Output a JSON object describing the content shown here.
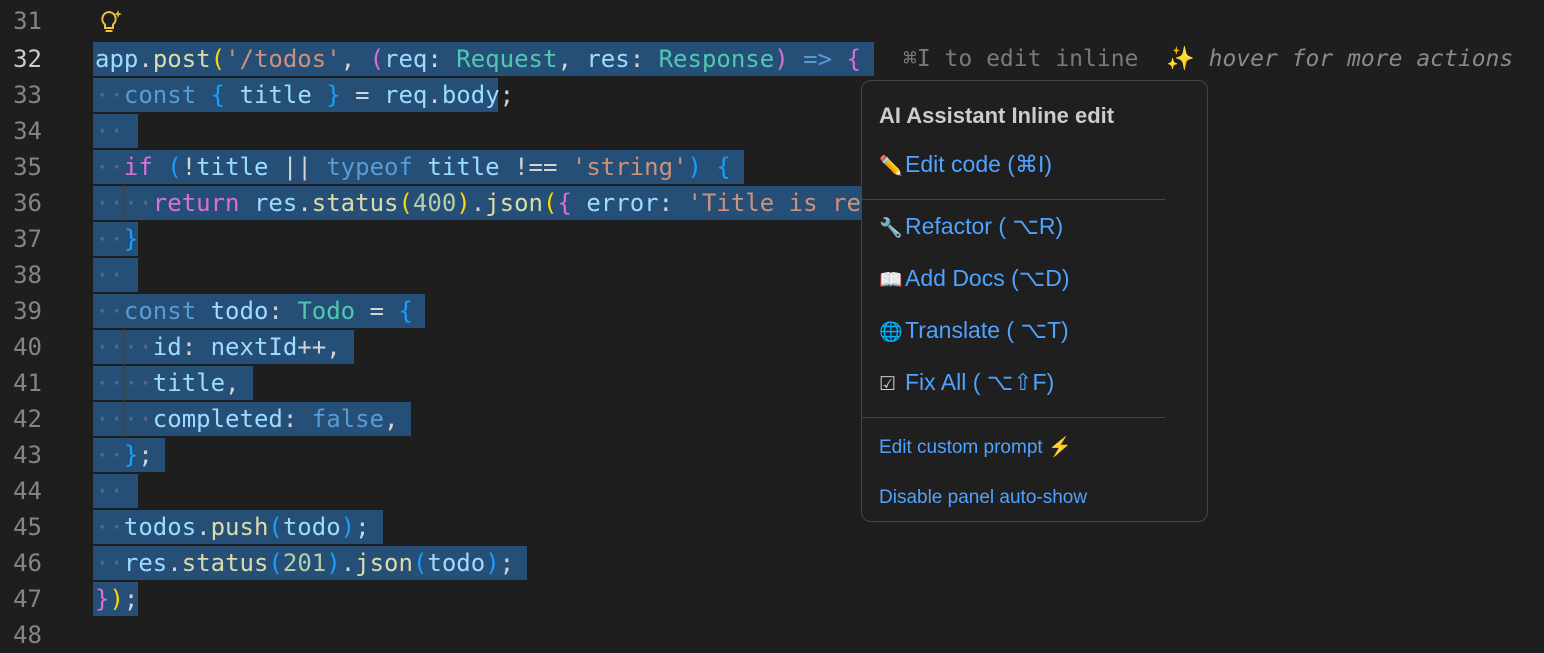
{
  "colors": {
    "background": "#1e1e1e",
    "selection": "#264f78",
    "line_number": "#858585",
    "link": "#4fa3ff"
  },
  "gutter": {
    "line_numbers": [
      "31",
      "32",
      "33",
      "34",
      "35",
      "36",
      "37",
      "38",
      "39",
      "40",
      "41",
      "42",
      "43",
      "44",
      "45",
      "46",
      "47",
      "48"
    ],
    "active_line": "32"
  },
  "inline_hint": {
    "shortcut_text": "⌘I to edit inline",
    "sparkle": "✨",
    "more_text": "hover for more actions"
  },
  "lightbulb_icon": "lightbulb-sparkle-icon",
  "code": {
    "l32": {
      "a": "app",
      "b": ".",
      "c": "post",
      "d": "(",
      "e": "'/todos'",
      "f": ", ",
      "g": "(",
      "h": "req",
      "i": ": ",
      "j": "Request",
      "k": ", ",
      "l": "res",
      "m": ": ",
      "n": "Response",
      "o": ")",
      "p": " ",
      "q": "=>",
      "r": " ",
      "s": "{"
    },
    "l33": {
      "a": "const",
      "b": "{",
      "c": "title",
      "d": "}",
      "e": " = ",
      "f": "req",
      "g": ".",
      "h": "body",
      "i": ";"
    },
    "l35": {
      "a": "if",
      "b": "(",
      "c": "!",
      "d": "title",
      "e": " || ",
      "f": "typeof",
      "g": "title",
      "h": " !== ",
      "i": "'string'",
      "j": ")",
      "k": "{"
    },
    "l36": {
      "a": "return",
      "b": "res",
      "c": ".",
      "d": "status",
      "e": "(",
      "f": "400",
      "g": ")",
      "h": ".",
      "i": "json",
      "j": "(",
      "k": "{",
      "l": "error",
      "m": ": ",
      "n": "'Title is re"
    },
    "l37": {
      "a": "}"
    },
    "l39": {
      "a": "const",
      "b": "todo",
      "c": ": ",
      "d": "Todo",
      "e": " = ",
      "f": "{"
    },
    "l40": {
      "a": "id",
      "b": ": ",
      "c": "nextId",
      "d": "++,"
    },
    "l41": {
      "a": "title",
      "b": ","
    },
    "l42": {
      "a": "completed",
      "b": ": ",
      "c": "false",
      "d": ","
    },
    "l43": {
      "a": "}",
      "b": ";"
    },
    "l45": {
      "a": "todos",
      "b": ".",
      "c": "push",
      "d": "(",
      "e": "todo",
      "f": ")",
      "g": ";"
    },
    "l46": {
      "a": "res",
      "b": ".",
      "c": "status",
      "d": "(",
      "e": "201",
      "f": ")",
      "g": ".",
      "h": "json",
      "i": "(",
      "j": "todo",
      "k": ")",
      "l": ";"
    },
    "l47": {
      "a": "}",
      "b": ")",
      "c": ";"
    }
  },
  "popup": {
    "title": "AI Assistant Inline edit",
    "items": [
      {
        "icon": "✏️",
        "icon_name": "pencil-icon",
        "label": "Edit code (⌘I)"
      },
      {
        "icon": "🔧",
        "icon_name": "wrench-icon",
        "label": "Refactor ( ⌥R)"
      },
      {
        "icon": "📖",
        "icon_name": "book-icon",
        "label": "Add Docs (⌥D)"
      },
      {
        "icon": "🌐",
        "icon_name": "globe-icon",
        "label": "Translate ( ⌥T)"
      },
      {
        "icon": "☑",
        "icon_name": "checkbox-icon",
        "label": "Fix All ( ⌥⇧F)"
      }
    ],
    "custom_prompt": "Edit custom prompt ⚡",
    "disable": "Disable panel auto-show"
  }
}
